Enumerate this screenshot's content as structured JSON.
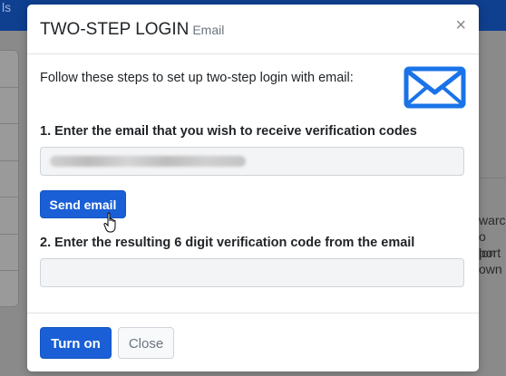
{
  "background": {
    "topbar_fragments": [
      "ls"
    ],
    "right_fragments": [
      "warc",
      "o lon",
      "port",
      "own"
    ]
  },
  "modal": {
    "title": "TWO-STEP LOGIN",
    "subtitle": "Email",
    "close_glyph": "×",
    "intro": "Follow these steps to set up two-step login with email:",
    "icon": "envelope-icon",
    "step1_label": "1. Enter the email that you wish to receive verification codes",
    "email_value": "",
    "send_email_label": "Send email",
    "step2_label": "2. Enter the resulting 6 digit verification code from the email",
    "code_value": "",
    "turn_on_label": "Turn on",
    "close_label": "Close"
  },
  "colors": {
    "primary": "#1a5fd6",
    "topbar": "#0f3f8f",
    "overlay": "#8a8a8a"
  }
}
